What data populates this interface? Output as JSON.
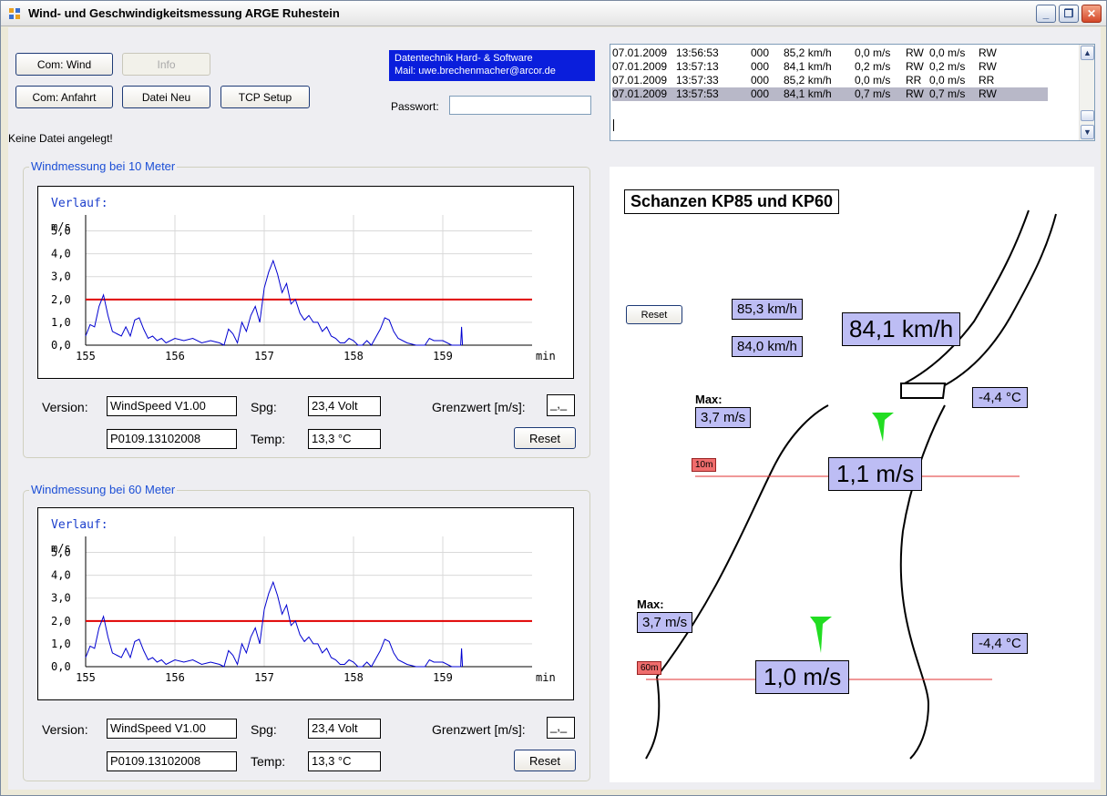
{
  "window": {
    "title": "Wind- und Geschwindigkeitsmessung ARGE Ruhestein"
  },
  "toolbar": {
    "com_wind": "Com: Wind",
    "info": "Info",
    "com_anfahrt": "Com: Anfahrt",
    "datei_neu": "Datei Neu",
    "tcp_setup": "TCP Setup"
  },
  "company": {
    "line1": "Datentechnik Hard- & Software",
    "line2": "Mail: uwe.brechenmacher@arcor.de"
  },
  "password": {
    "label": "Passwort:",
    "value": ""
  },
  "status": "Keine Datei angelegt!",
  "log": {
    "rows": [
      {
        "date": "07.01.2009",
        "time": "13:56:53",
        "code": "000",
        "speed": "85,2 km/h",
        "wind1": "0,0 m/s",
        "dir1": "RW",
        "wind2": "0,0 m/s",
        "dir2": "RW",
        "selected": false
      },
      {
        "date": "07.01.2009",
        "time": "13:57:13",
        "code": "000",
        "speed": "84,1 km/h",
        "wind1": "0,2 m/s",
        "dir1": "RW",
        "wind2": "0,2 m/s",
        "dir2": "RW",
        "selected": false
      },
      {
        "date": "07.01.2009",
        "time": "13:57:33",
        "code": "000",
        "speed": "85,2 km/h",
        "wind1": "0,0 m/s",
        "dir1": "RR",
        "wind2": "0,0 m/s",
        "dir2": "RR",
        "selected": false
      },
      {
        "date": "07.01.2009",
        "time": "13:57:53",
        "code": "000",
        "speed": "84,1 km/h",
        "wind1": "0,7 m/s",
        "dir1": "RW",
        "wind2": "0,7 m/s",
        "dir2": "RW",
        "selected": true
      }
    ]
  },
  "groups": [
    {
      "legend": "Windmessung bei 10 Meter",
      "version_label": "Version:",
      "version": "WindSpeed V1.00",
      "serial": "P0109.13102008",
      "spg_label": "Spg:",
      "spg": "23,4 Volt",
      "temp_label": "Temp:",
      "temp": "13,3 °C",
      "grenz_label": "Grenzwert [m/s]:",
      "grenz": "_,_",
      "reset": "Reset"
    },
    {
      "legend": "Windmessung bei 60 Meter",
      "version_label": "Version:",
      "version": "WindSpeed V1.00",
      "serial": "P0109.13102008",
      "spg_label": "Spg:",
      "spg": "23,4 Volt",
      "temp_label": "Temp:",
      "temp": "13,3 °C",
      "grenz_label": "Grenzwert [m/s]:",
      "grenz": "_,_",
      "reset": "Reset"
    }
  ],
  "chart_data": [
    {
      "type": "line",
      "title": "Verlauf:",
      "ylabel": "m/s",
      "xlabel": "min",
      "xlim": [
        155,
        160
      ],
      "ylim": [
        0,
        5.7
      ],
      "xticks": [
        "155",
        "156",
        "157",
        "158",
        "159"
      ],
      "yticks": [
        "0,0",
        "1,0",
        "2,0",
        "3,0",
        "4,0",
        "5,0"
      ],
      "grid": true,
      "threshold": {
        "value": 2.0,
        "color": "#e00000"
      },
      "series": [
        {
          "color": "#0000d0",
          "x": [
            155.0,
            155.05,
            155.1,
            155.15,
            155.2,
            155.25,
            155.3,
            155.35,
            155.4,
            155.45,
            155.5,
            155.55,
            155.6,
            155.65,
            155.7,
            155.75,
            155.8,
            155.85,
            155.9,
            156.0,
            156.1,
            156.2,
            156.3,
            156.4,
            156.5,
            156.55,
            156.6,
            156.65,
            156.7,
            156.75,
            156.8,
            156.85,
            156.9,
            156.95,
            157.0,
            157.05,
            157.1,
            157.15,
            157.2,
            157.25,
            157.3,
            157.35,
            157.4,
            157.45,
            157.5,
            157.55,
            157.6,
            157.65,
            157.7,
            157.75,
            157.8,
            157.85,
            157.9,
            157.95,
            158.0,
            158.05,
            158.1,
            158.15,
            158.2,
            158.3,
            158.35,
            158.4,
            158.45,
            158.5,
            158.6,
            158.7,
            158.8,
            158.85,
            158.9,
            159.0,
            159.1,
            159.2,
            159.21,
            159.22
          ],
          "y": [
            0.4,
            0.9,
            0.8,
            1.7,
            2.2,
            1.3,
            0.6,
            0.5,
            0.4,
            0.8,
            0.4,
            1.1,
            1.2,
            0.7,
            0.3,
            0.4,
            0.2,
            0.3,
            0.1,
            0.3,
            0.2,
            0.3,
            0.1,
            0.2,
            0.1,
            0.0,
            0.7,
            0.5,
            0.1,
            1.0,
            0.6,
            1.3,
            1.7,
            1.0,
            2.5,
            3.2,
            3.7,
            3.1,
            2.3,
            2.7,
            1.8,
            2.0,
            1.4,
            1.1,
            1.3,
            1.0,
            1.0,
            0.6,
            0.8,
            0.4,
            0.3,
            0.1,
            0.1,
            0.3,
            0.2,
            0.0,
            0.0,
            0.2,
            0.0,
            0.7,
            1.2,
            1.1,
            0.6,
            0.3,
            0.1,
            0.0,
            0.0,
            0.3,
            0.2,
            0.2,
            0.0,
            0.0,
            0.8,
            0.0
          ]
        }
      ]
    },
    {
      "type": "line",
      "title": "Verlauf:",
      "ylabel": "m/s",
      "xlabel": "min",
      "xlim": [
        155,
        160
      ],
      "ylim": [
        0,
        5.7
      ],
      "xticks": [
        "155",
        "156",
        "157",
        "158",
        "159"
      ],
      "yticks": [
        "0,0",
        "1,0",
        "2,0",
        "3,0",
        "4,0",
        "5,0"
      ],
      "grid": true,
      "threshold": {
        "value": 2.0,
        "color": "#e00000"
      },
      "series": [
        {
          "color": "#0000d0",
          "x": [
            155.0,
            155.05,
            155.1,
            155.15,
            155.2,
            155.25,
            155.3,
            155.35,
            155.4,
            155.45,
            155.5,
            155.55,
            155.6,
            155.65,
            155.7,
            155.75,
            155.8,
            155.85,
            155.9,
            156.0,
            156.1,
            156.2,
            156.3,
            156.4,
            156.5,
            156.55,
            156.6,
            156.65,
            156.7,
            156.75,
            156.8,
            156.85,
            156.9,
            156.95,
            157.0,
            157.05,
            157.1,
            157.15,
            157.2,
            157.25,
            157.3,
            157.35,
            157.4,
            157.45,
            157.5,
            157.55,
            157.6,
            157.65,
            157.7,
            157.75,
            157.8,
            157.85,
            157.9,
            157.95,
            158.0,
            158.05,
            158.1,
            158.15,
            158.2,
            158.3,
            158.35,
            158.4,
            158.45,
            158.5,
            158.6,
            158.7,
            158.8,
            158.85,
            158.9,
            159.0,
            159.1,
            159.2,
            159.21,
            159.22
          ],
          "y": [
            0.4,
            0.9,
            0.8,
            1.7,
            2.2,
            1.3,
            0.6,
            0.5,
            0.4,
            0.8,
            0.4,
            1.1,
            1.2,
            0.7,
            0.3,
            0.4,
            0.2,
            0.3,
            0.1,
            0.3,
            0.2,
            0.3,
            0.1,
            0.2,
            0.1,
            0.0,
            0.7,
            0.5,
            0.1,
            1.0,
            0.6,
            1.3,
            1.7,
            1.0,
            2.5,
            3.2,
            3.7,
            3.1,
            2.3,
            2.7,
            1.8,
            2.0,
            1.4,
            1.1,
            1.3,
            1.0,
            1.0,
            0.6,
            0.8,
            0.4,
            0.3,
            0.1,
            0.1,
            0.3,
            0.2,
            0.0,
            0.0,
            0.2,
            0.0,
            0.7,
            1.2,
            1.1,
            0.6,
            0.3,
            0.1,
            0.0,
            0.0,
            0.3,
            0.2,
            0.2,
            0.0,
            0.0,
            0.8,
            0.0
          ]
        }
      ]
    }
  ],
  "scene": {
    "title": "Schanzen KP85 und KP60",
    "reset": "Reset",
    "speed_prev1": "85,3 km/h",
    "speed_prev2": "84,0 km/h",
    "speed_current": "84,1 km/h",
    "temp_top": "-4,4 °C",
    "max_label_10": "Max:",
    "max_10": "3,7 m/s",
    "marker_10": "10m",
    "wind_10": "1,1 m/s",
    "max_label_60": "Max:",
    "max_60": "3,7 m/s",
    "marker_60": "60m",
    "wind_60": "1,0 m/s",
    "temp_bottom": "-4,4 °C",
    "arrow_color": "#22dd22"
  }
}
